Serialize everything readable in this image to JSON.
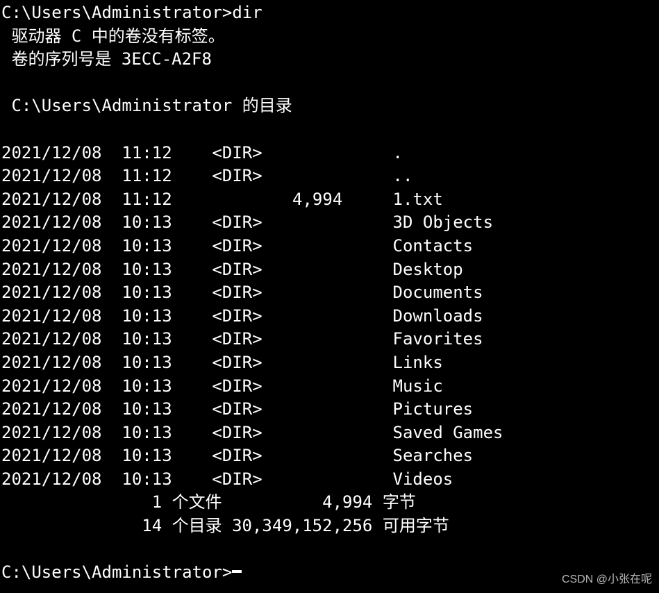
{
  "prompt1": {
    "path": "C:\\Users\\Administrator>",
    "command": "dir"
  },
  "header": {
    "line1": " 驱动器 C 中的卷没有标签。",
    "line2": " 卷的序列号是 3ECC-A2F8",
    "line3": " C:\\Users\\Administrator 的目录"
  },
  "entries": [
    {
      "date": "2021/12/08",
      "time": "11:12",
      "type": "<DIR>",
      "size": "",
      "name": "."
    },
    {
      "date": "2021/12/08",
      "time": "11:12",
      "type": "<DIR>",
      "size": "",
      "name": ".."
    },
    {
      "date": "2021/12/08",
      "time": "11:12",
      "type": "",
      "size": "4,994",
      "name": "1.txt"
    },
    {
      "date": "2021/12/08",
      "time": "10:13",
      "type": "<DIR>",
      "size": "",
      "name": "3D Objects"
    },
    {
      "date": "2021/12/08",
      "time": "10:13",
      "type": "<DIR>",
      "size": "",
      "name": "Contacts"
    },
    {
      "date": "2021/12/08",
      "time": "10:13",
      "type": "<DIR>",
      "size": "",
      "name": "Desktop"
    },
    {
      "date": "2021/12/08",
      "time": "10:13",
      "type": "<DIR>",
      "size": "",
      "name": "Documents"
    },
    {
      "date": "2021/12/08",
      "time": "10:13",
      "type": "<DIR>",
      "size": "",
      "name": "Downloads"
    },
    {
      "date": "2021/12/08",
      "time": "10:13",
      "type": "<DIR>",
      "size": "",
      "name": "Favorites"
    },
    {
      "date": "2021/12/08",
      "time": "10:13",
      "type": "<DIR>",
      "size": "",
      "name": "Links"
    },
    {
      "date": "2021/12/08",
      "time": "10:13",
      "type": "<DIR>",
      "size": "",
      "name": "Music"
    },
    {
      "date": "2021/12/08",
      "time": "10:13",
      "type": "<DIR>",
      "size": "",
      "name": "Pictures"
    },
    {
      "date": "2021/12/08",
      "time": "10:13",
      "type": "<DIR>",
      "size": "",
      "name": "Saved Games"
    },
    {
      "date": "2021/12/08",
      "time": "10:13",
      "type": "<DIR>",
      "size": "",
      "name": "Searches"
    },
    {
      "date": "2021/12/08",
      "time": "10:13",
      "type": "<DIR>",
      "size": "",
      "name": "Videos"
    }
  ],
  "summary": {
    "files_count": "1",
    "files_label": "个文件",
    "files_bytes": "4,994",
    "files_bytes_label": "字节",
    "dirs_count": "14",
    "dirs_label": "个目录",
    "free_bytes": "30,349,152,256",
    "free_label": "可用字节"
  },
  "prompt2": {
    "path": "C:\\Users\\Administrator>"
  },
  "watermark": "CSDN @小张在呢"
}
